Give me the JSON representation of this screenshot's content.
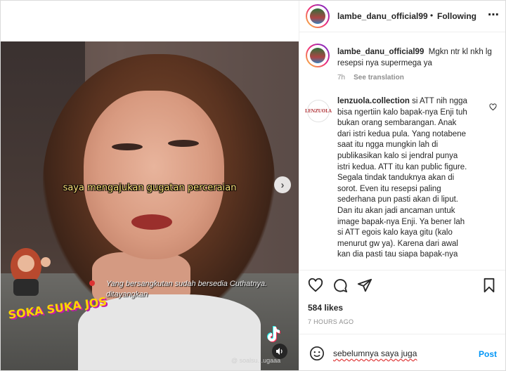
{
  "video": {
    "caption": "saya mengajukan gugatan perceraian",
    "subtitle": "Yang bersangkutan sudah bersedia Cuthatnya. ditayangkan",
    "sticker_text": "SOKA SUKA JOS",
    "watermark": "@ soalsu...ugaaa"
  },
  "header": {
    "username": "lambe_danu_official99",
    "separator": "•",
    "follow_state": "Following",
    "more": "⋯"
  },
  "caption_comment": {
    "username": "lambe_danu_official99",
    "text": "Mgkn ntr kl nkh lg resepsi nya supermega ya",
    "time": "7h",
    "see_translation": "See translation"
  },
  "comment": {
    "username": "lenzuola.collection",
    "avatar_text": "LENZUOLA",
    "lines": [
      "si ATT nih ngga",
      "bisa ngertiin kalo bapak-nya Enji tuh",
      "bukan orang sembarangan. Anak",
      "dari istri kedua pula. Yang notabene",
      "saat itu ngga mungkin lah di",
      "publikasikan kalo si jendral punya",
      "istri kedua. ATT itu kan public figure.",
      "Segala tindak tanduknya akan di",
      "sorot. Even itu resepsi paling",
      "sederhana pun pasti akan di liput.",
      "Dan itu akan jadi ancaman untuk",
      "image bapak-nya Enji. Ya bener lah",
      "si ATT egois kalo kaya gitu (kalo",
      "menurut gw ya). Karena dari awal",
      "kan dia pasti tau siapa bapak-nya"
    ]
  },
  "post": {
    "likes": "584 likes",
    "time": "7 HOURS AGO"
  },
  "add_comment": {
    "value": "sebelumnya saya juga",
    "post_label": "Post"
  },
  "colors": {
    "accent": "#0095f6",
    "caption_yellow": "#ffe27a"
  }
}
